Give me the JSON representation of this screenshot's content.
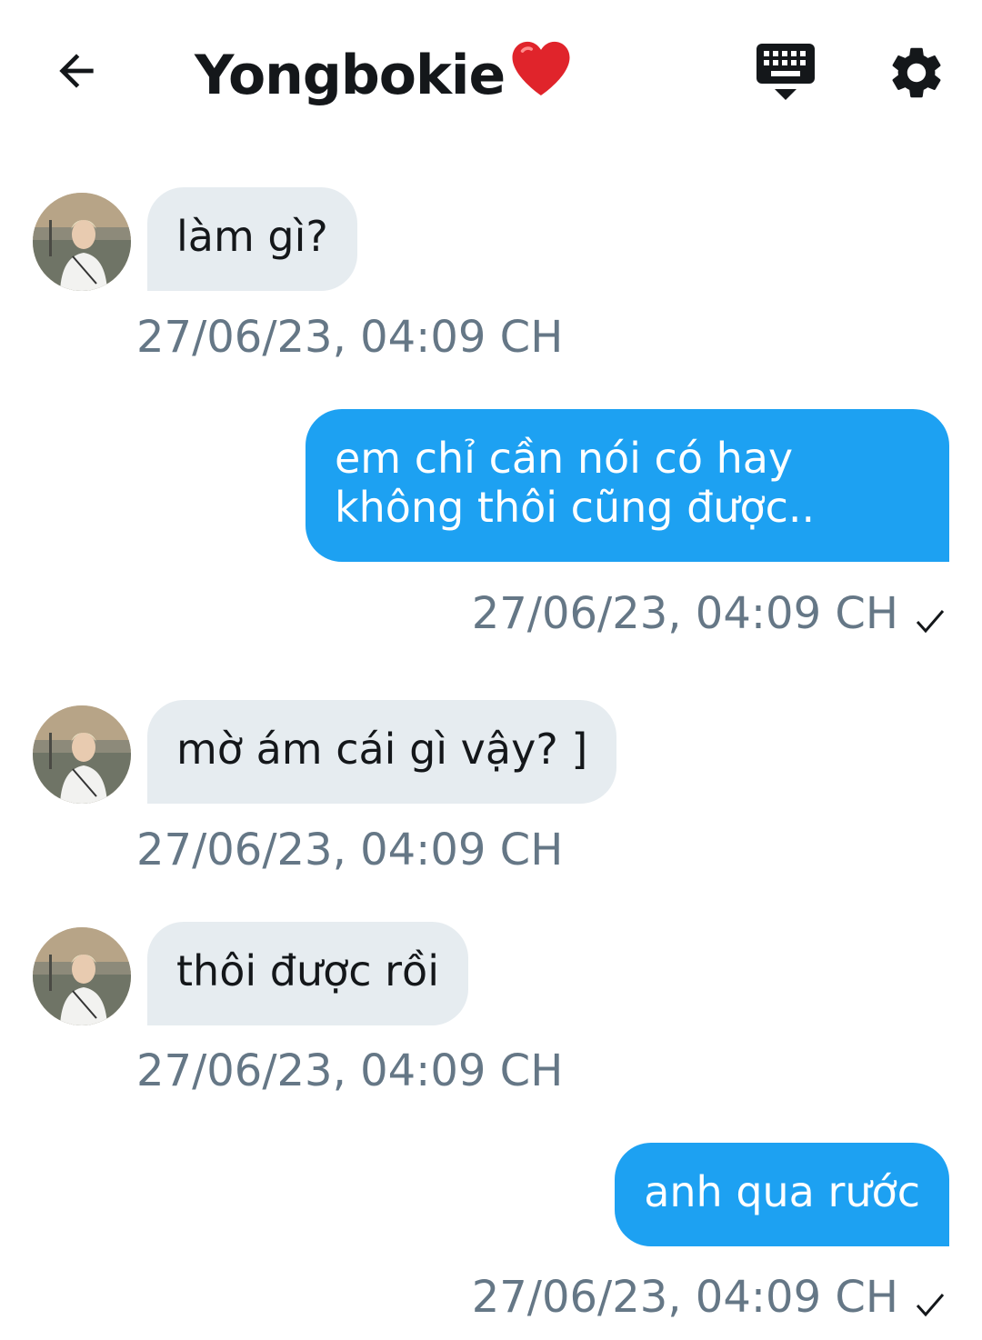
{
  "header": {
    "title": "Yongbokie",
    "title_emoji": "❤️",
    "back_icon": "arrow-left-icon",
    "keyboard_icon": "keyboard-icon",
    "settings_icon": "gear-icon"
  },
  "messages": [
    {
      "direction": "in",
      "text": "làm gì?",
      "timestamp": "27/06/23, 04:09 CH"
    },
    {
      "direction": "out",
      "lines": [
        "em chỉ cần nói có hay",
        "không thôi cũng được.."
      ],
      "timestamp": "27/06/23, 04:09 CH",
      "status": "sent"
    },
    {
      "direction": "in",
      "text": "mờ ám cái gì vậy? ]",
      "timestamp": "27/06/23, 04:09 CH"
    },
    {
      "direction": "in",
      "text": "thôi được rồi",
      "timestamp": "27/06/23, 04:09 CH"
    },
    {
      "direction": "out",
      "text": "anh qua rước",
      "timestamp": "27/06/23, 04:09 CH",
      "status": "sent"
    }
  ],
  "colors": {
    "incoming_bubble": "#e6ecf0",
    "outgoing_bubble": "#1da1f2",
    "timestamp": "#657786",
    "text": "#14171a"
  }
}
